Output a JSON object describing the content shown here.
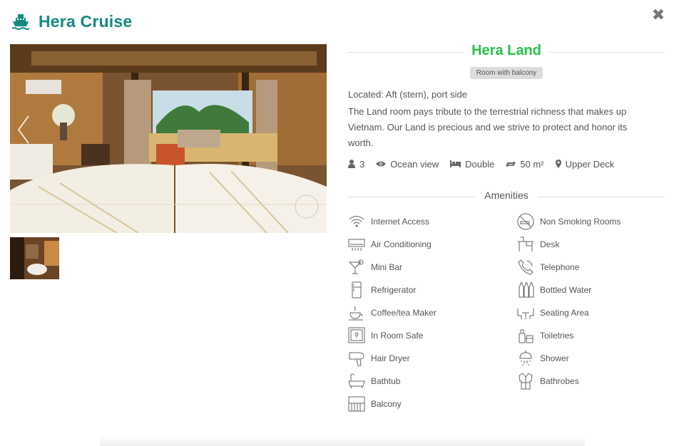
{
  "header": {
    "title": "Hera Cruise",
    "logo_icon": "ship-icon",
    "brand_color": "#138a83"
  },
  "close_icon": "close-icon",
  "gallery": {
    "prev_icon": "chevron-left-icon",
    "next_icon": "chevron-right-icon"
  },
  "room": {
    "title": "Hera Land",
    "title_color": "#2ac04a",
    "badge": "Room with balcony",
    "located": "Located: Aft (stern), port side",
    "description": "The Land room pays tribute to the terrestrial richness that makes up Vietnam. Our Land is precious and we strive to protect and honor its worth."
  },
  "specs": [
    {
      "icon": "user-icon",
      "label": "3"
    },
    {
      "icon": "eye-icon",
      "label": "Ocean view"
    },
    {
      "icon": "bed-icon",
      "label": "Double"
    },
    {
      "icon": "area-icon",
      "label": "50 m²"
    },
    {
      "icon": "map-marker-icon",
      "label": "Upper Deck"
    }
  ],
  "amenities_title": "Amenities",
  "amenities_left": [
    {
      "icon": "wifi-icon",
      "label": "Internet Access"
    },
    {
      "icon": "air-conditioner-icon",
      "label": "Air Conditioning"
    },
    {
      "icon": "cocktail-icon",
      "label": "Mini Bar"
    },
    {
      "icon": "fridge-icon",
      "label": "Refrigerator"
    },
    {
      "icon": "coffee-icon",
      "label": "Coffee/tea Maker"
    },
    {
      "icon": "safe-icon",
      "label": "In Room Safe"
    },
    {
      "icon": "hair-dryer-icon",
      "label": "Hair Dryer"
    },
    {
      "icon": "bathtub-icon",
      "label": "Bathtub"
    },
    {
      "icon": "balcony-icon",
      "label": "Balcony"
    }
  ],
  "amenities_right": [
    {
      "icon": "no-smoking-icon",
      "label": "Non Smoking Rooms"
    },
    {
      "icon": "desk-icon",
      "label": "Desk"
    },
    {
      "icon": "telephone-icon",
      "label": "Telephone"
    },
    {
      "icon": "bottles-icon",
      "label": "Bottled Water"
    },
    {
      "icon": "seating-icon",
      "label": "Seating Area"
    },
    {
      "icon": "toiletries-icon",
      "label": "Toiletries"
    },
    {
      "icon": "shower-icon",
      "label": "Shower"
    },
    {
      "icon": "bathrobe-icon",
      "label": "Bathrobes"
    }
  ]
}
